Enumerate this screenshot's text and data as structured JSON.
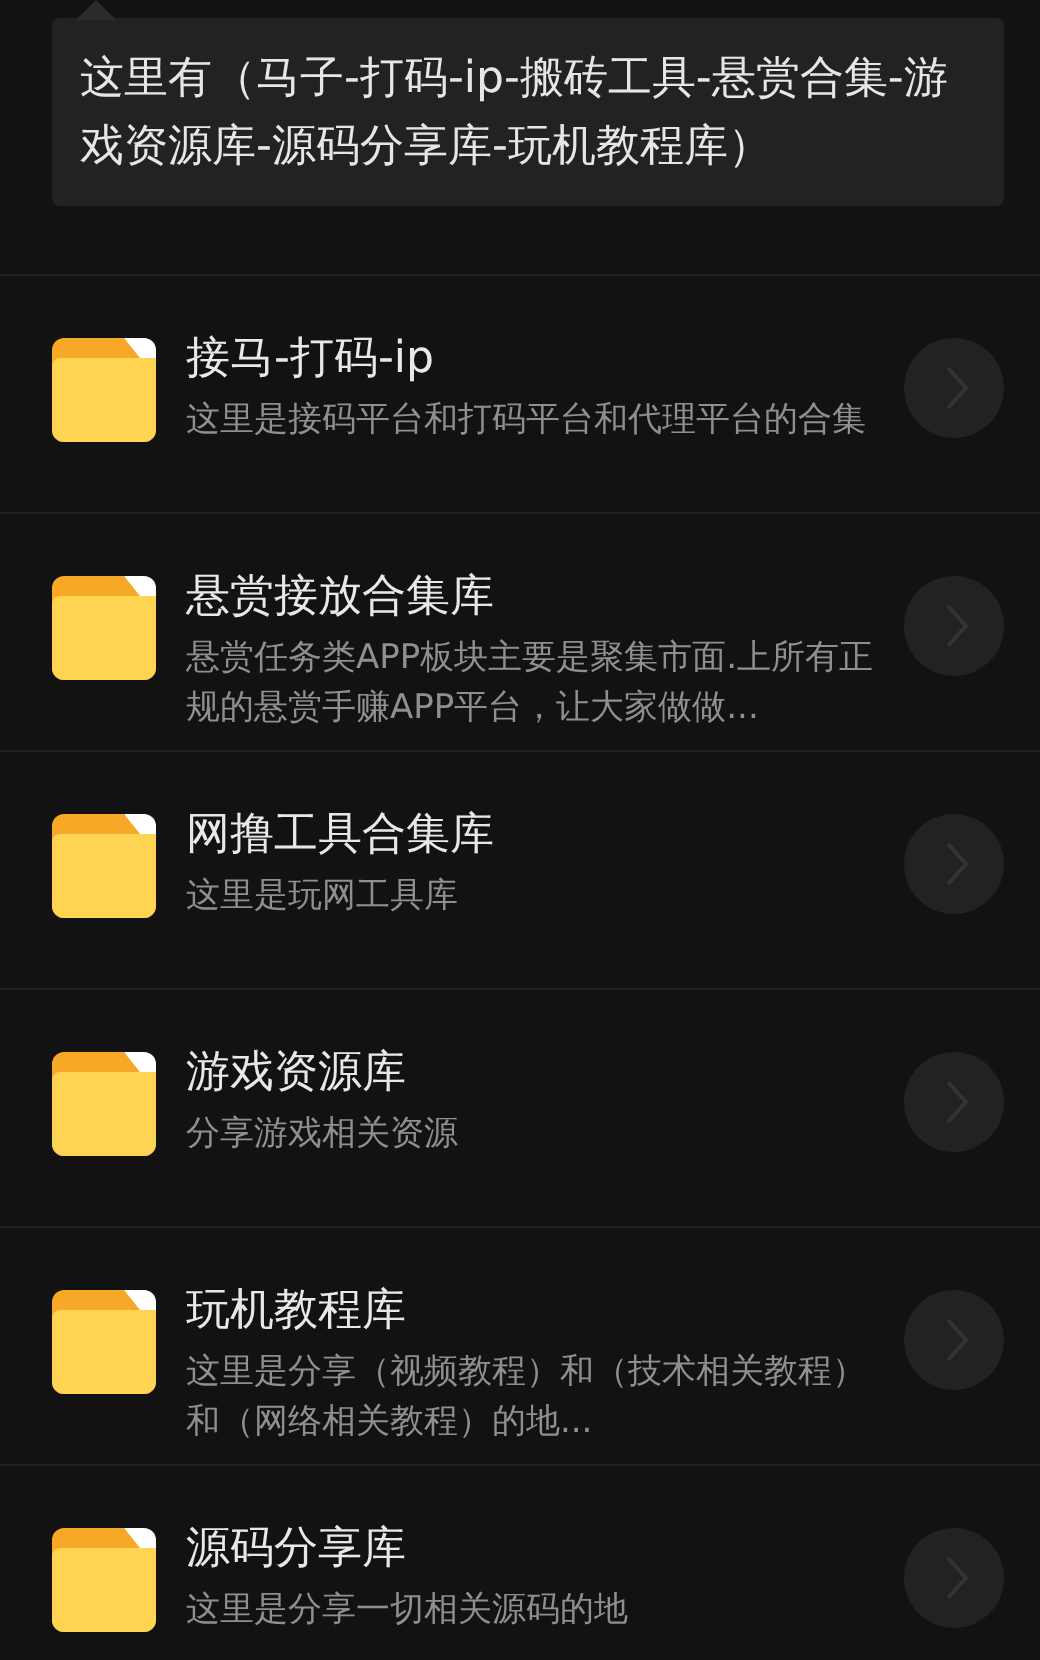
{
  "tooltip": {
    "text": "这里有（马子-打码-ip-搬砖工具-悬赏合集-游戏资源库-源码分享库-玩机教程库）"
  },
  "items": [
    {
      "title": "接马-打码-ip",
      "description": "这里是接码平台和打码平台和代理平台的合集"
    },
    {
      "title": "悬赏接放合集库",
      "description": "悬赏任务类APP板块主要是聚集市面.上所有正规的悬赏手赚APP平台，让大家做做..."
    },
    {
      "title": "网撸工具合集库",
      "description": "这里是玩网工具库"
    },
    {
      "title": "游戏资源库",
      "description": "分享游戏相关资源"
    },
    {
      "title": "玩机教程库",
      "description": "这里是分享（视频教程）和（技术相关教程）和（网络相关教程）的地..."
    },
    {
      "title": "源码分享库",
      "description": "这里是分享一切相关源码的地"
    }
  ]
}
